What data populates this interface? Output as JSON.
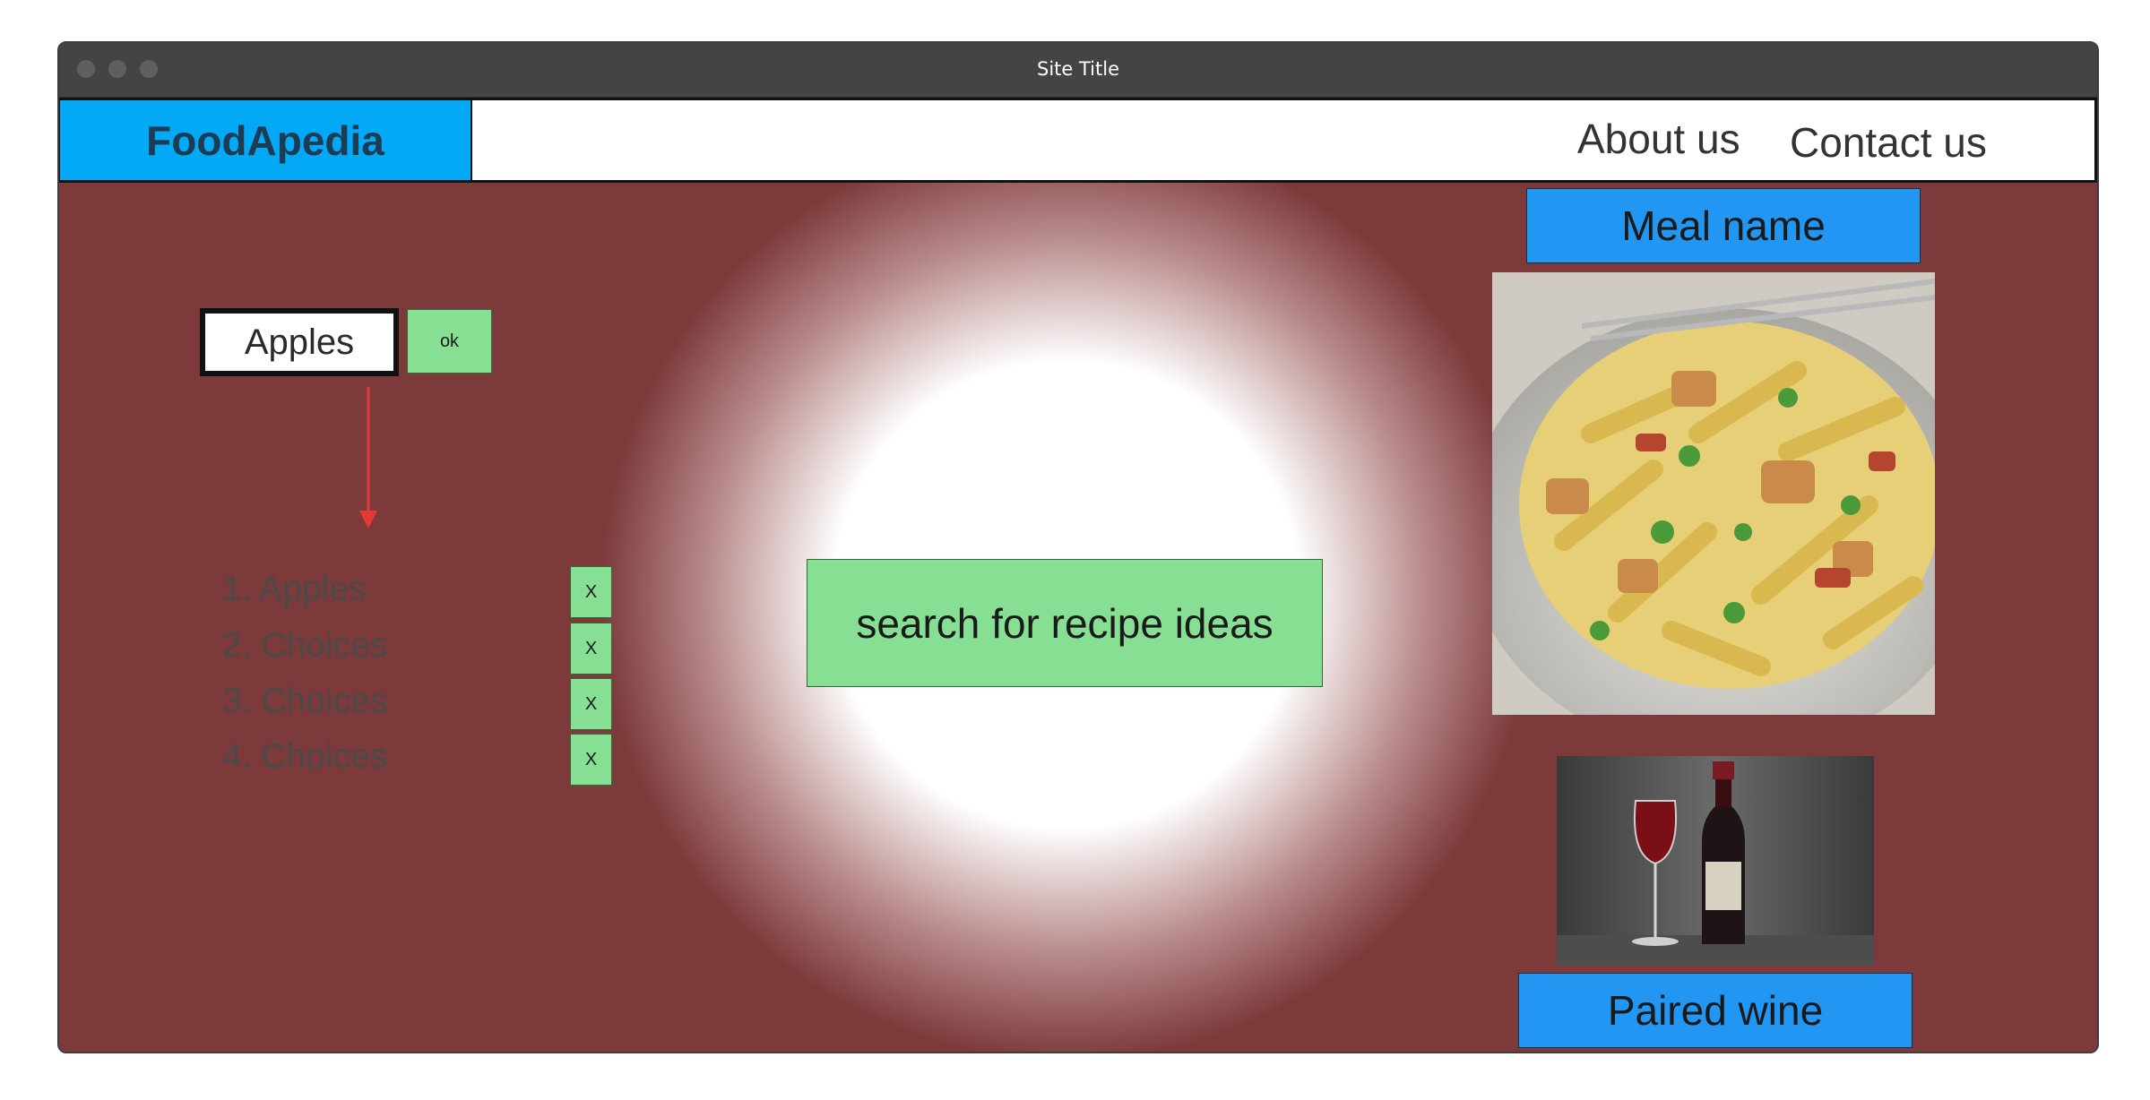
{
  "window": {
    "title": "Site Title"
  },
  "navbar": {
    "brand": "FoodApedia",
    "links": [
      {
        "label": "About us"
      },
      {
        "label": "Contact us"
      }
    ]
  },
  "ingredient_entry": {
    "value": "Apples",
    "ok_label": "ok"
  },
  "choices": [
    {
      "label": "1. Apples",
      "remove_label": "X"
    },
    {
      "label": "2. Choices",
      "remove_label": "X"
    },
    {
      "label": "3. Choices",
      "remove_label": "X"
    },
    {
      "label": "4. Choices",
      "remove_label": "X"
    }
  ],
  "search": {
    "label": "search for recipe ideas"
  },
  "meal": {
    "name_label": "Meal name",
    "image_icon": "pasta-dish-photo"
  },
  "wine": {
    "label": "Paired wine",
    "image_icon": "wine-bottle-photo"
  },
  "colors": {
    "background": "#7d3a3b",
    "brand_bg": "#03a9f4",
    "button_green": "#86df93",
    "label_blue": "#2196f3",
    "arrow_red": "#e53935"
  }
}
